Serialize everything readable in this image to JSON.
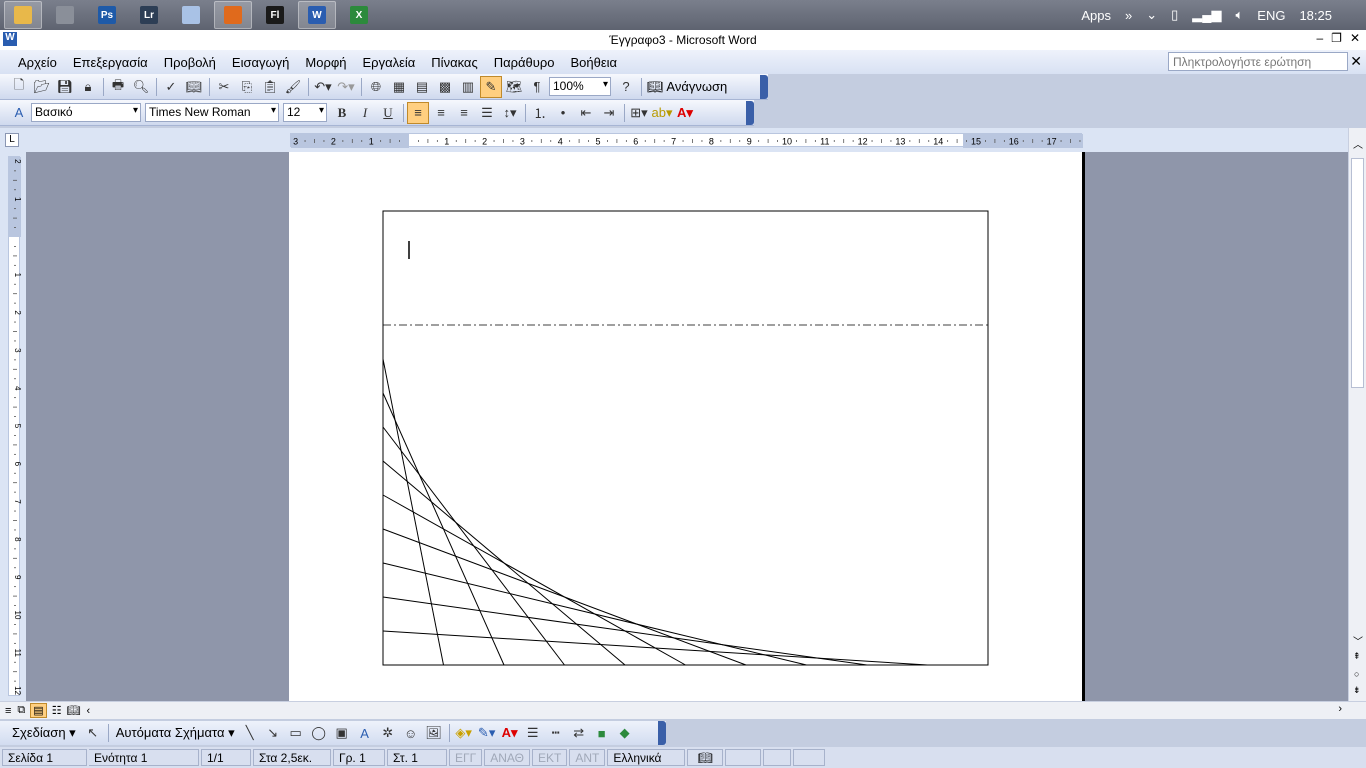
{
  "taskbar": {
    "apps": [
      {
        "name": "file-explorer-icon",
        "label": "",
        "active": true,
        "color": "#e8b84a"
      },
      {
        "name": "settings-app-icon",
        "label": "",
        "active": false,
        "color": "#8a8f99"
      },
      {
        "name": "photoshop-icon",
        "label": "Ps",
        "active": false,
        "color": "#1e5aa8"
      },
      {
        "name": "lightroom-icon",
        "label": "Lr",
        "active": false,
        "color": "#2d3e55"
      },
      {
        "name": "calculator-icon",
        "label": "",
        "active": false,
        "color": "#a9c2e6"
      },
      {
        "name": "firefox-icon",
        "label": "",
        "active": true,
        "color": "#e06a1c"
      },
      {
        "name": "flash-icon",
        "label": "Fl",
        "active": false,
        "color": "#1a1a1a"
      },
      {
        "name": "word-icon",
        "label": "W",
        "active": true,
        "color": "#2a5db0"
      },
      {
        "name": "excel-icon",
        "label": "X",
        "active": false,
        "color": "#2c8a3c"
      }
    ],
    "apps_label": "Apps",
    "lang": "ENG",
    "time": "18:25"
  },
  "window": {
    "title": "Έγγραφο3 - Microsoft Word"
  },
  "menu": {
    "items": [
      "Αρχείο",
      "Επεξεργασία",
      "Προβολή",
      "Εισαγωγή",
      "Μορφή",
      "Εργαλεία",
      "Πίνακας",
      "Παράθυρο",
      "Βοήθεια"
    ],
    "help_placeholder": "Πληκτρολογήστε ερώτηση"
  },
  "standard_toolbar": {
    "zoom": "100%",
    "reading_label": "Ανάγνωση"
  },
  "format_toolbar": {
    "style": "Βασικό",
    "font": "Times New Roman",
    "size": "12",
    "bold": "B",
    "italic": "I",
    "underline": "U"
  },
  "ruler": {
    "labels": [
      "3",
      "2",
      "1",
      "",
      "1",
      "2",
      "3",
      "4",
      "5",
      "6",
      "7",
      "8",
      "9",
      "10",
      "11",
      "12",
      "13",
      "14",
      "15",
      "16",
      "17"
    ]
  },
  "vruler": {
    "labels": [
      "2",
      "1",
      "",
      "1",
      "2",
      "3",
      "4",
      "5",
      "6",
      "7",
      "8",
      "9",
      "10",
      "11",
      "12"
    ]
  },
  "drawing_toolbar": {
    "draw_label": "Σχεδίαση",
    "autoshapes_label": "Αυτόματα Σχήματα"
  },
  "status": {
    "page": "Σελίδα 1",
    "section": "Ενότητα 1",
    "pages": "1/1",
    "at": "Στα 2,5εκ.",
    "line": "Γρ. 1",
    "col": "Στ. 1",
    "rec": "ΕΓΓ",
    "trk": "ΑΝΑΘ",
    "ext": "ΕΚΤ",
    "ovr": "ΑΝΤ",
    "language": "Ελληνικά"
  },
  "colors": {
    "accent": "#3a5fa8",
    "highlight": "#ffcf80",
    "workspace": "#8f96aa"
  }
}
